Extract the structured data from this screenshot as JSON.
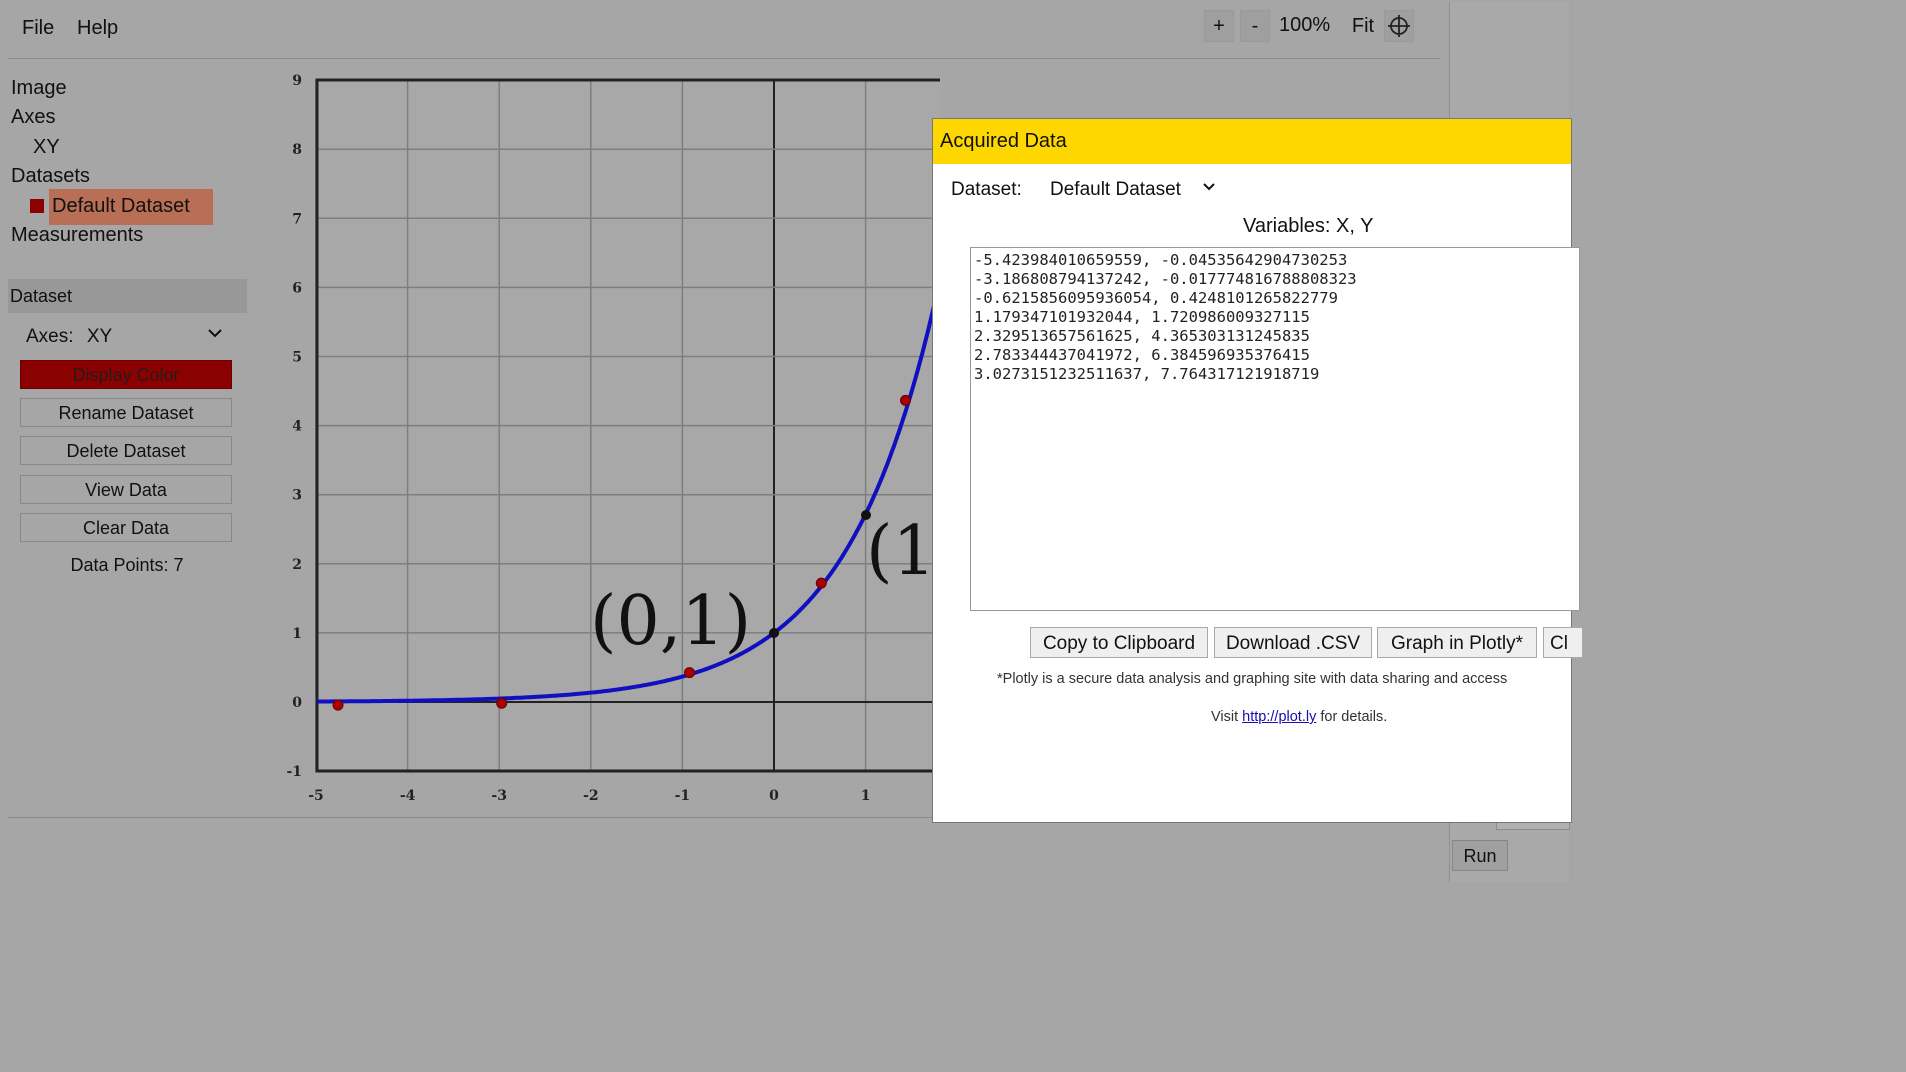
{
  "menu": {
    "file": "File",
    "help": "Help"
  },
  "zoom": {
    "plus": "+",
    "minus": "-",
    "level": "100%",
    "fit": "Fit"
  },
  "tree": {
    "image": "Image",
    "axes": "Axes",
    "axes_child": "XY",
    "datasets": "Datasets",
    "dataset_child": "Default Dataset",
    "measurements": "Measurements",
    "dataset_color": "#8b0000"
  },
  "dataset_panel": {
    "header": "Dataset",
    "axes_label": "Axes:",
    "axes_value": "XY",
    "buttons": [
      "Display Color",
      "Rename Dataset",
      "Delete Dataset",
      "View Data",
      "Clear Data"
    ],
    "points_label": "Data Points:",
    "points_count": "7"
  },
  "plot": {
    "x_ticks": [
      "-5",
      "-4",
      "-3",
      "-2",
      "-1",
      "0",
      "1"
    ],
    "y_ticks": [
      "9",
      "8",
      "7",
      "6",
      "5",
      "4",
      "3",
      "2",
      "1",
      "0",
      "-1"
    ],
    "annotation_0": "(0,1)",
    "annotation_1": "(1",
    "curve_color": "#1010c0",
    "marker_color": "#a80000",
    "points": [
      [
        -5.423984010659559,
        -0.04535642904730253
      ],
      [
        -3.186808794137242,
        -0.017774816788808323
      ],
      [
        -0.6215856095936054,
        0.4248101265822779
      ],
      [
        1.179347101932044,
        1.720986009327115
      ],
      [
        2.329513657561625,
        4.365303131245835
      ],
      [
        2.783344437041972,
        6.384596935376415
      ],
      [
        3.0273151232511637,
        7.764317121918719
      ]
    ]
  },
  "dialog": {
    "title": "Acquired Data",
    "dataset_label": "Dataset:",
    "dataset_value": "Default Dataset",
    "variables_label": "Variables: X, Y",
    "data_text": "-5.423984010659559, -0.04535642904730253\n-3.186808794137242, -0.017774816788808323\n-0.6215856095936054, 0.4248101265822779\n1.179347101932044, 1.720986009327115\n2.329513657561625, 4.365303131245835\n2.783344437041972, 6.384596935376415\n3.0273151232511637, 7.764317121918719",
    "buttons": [
      "Copy to Clipboard",
      "Download .CSV",
      "Graph in Plotly*",
      "Cl"
    ],
    "note": "*Plotly is a secure data analysis and graphing site with data sharing and access",
    "visit_prefix": "Visit ",
    "visit_link": "http://plot.ly",
    "visit_suffix": " for details."
  },
  "run_label": "Run"
}
